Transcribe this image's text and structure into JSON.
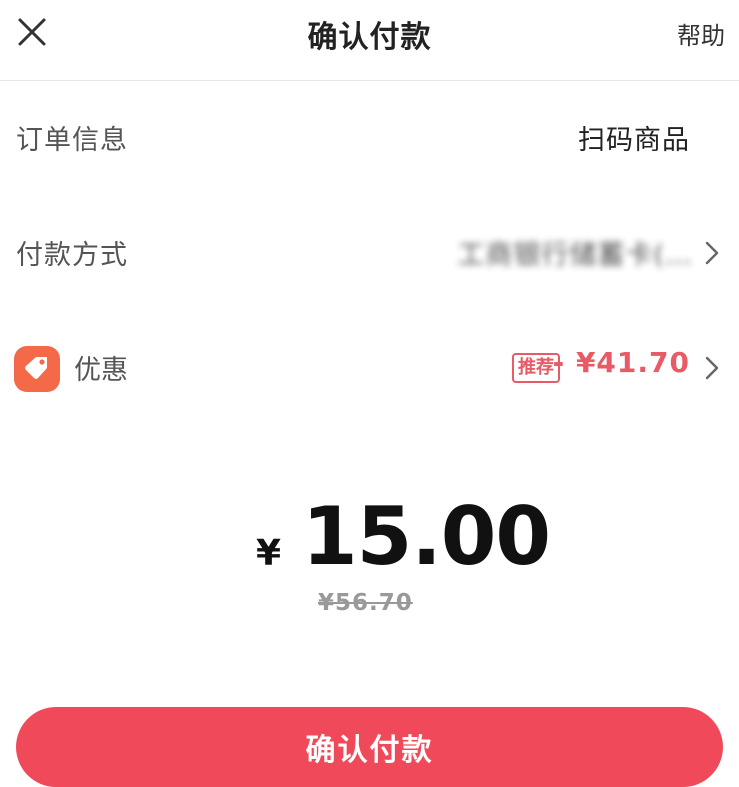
{
  "header": {
    "title": "确认付款",
    "help_label": "帮助",
    "close_icon": "close-icon"
  },
  "order_info": {
    "label": "订单信息",
    "value": "扫码商品"
  },
  "payment_method": {
    "label": "付款方式",
    "value": "工商银行储蓄卡(…",
    "chevron_icon": "chevron-right-icon"
  },
  "discount": {
    "label": "优惠",
    "icon": "coupon-tag-icon",
    "icon_color": "#f46a48",
    "badge": "推荐",
    "amount": "- ¥41.70",
    "accent_color": "#e85a66",
    "chevron_icon": "chevron-right-icon"
  },
  "payment": {
    "currency_symbol": "¥",
    "amount": "15.00",
    "original_price": "¥56.70"
  },
  "confirm_button": {
    "label": "确认付款",
    "color": "#f04a5a"
  }
}
